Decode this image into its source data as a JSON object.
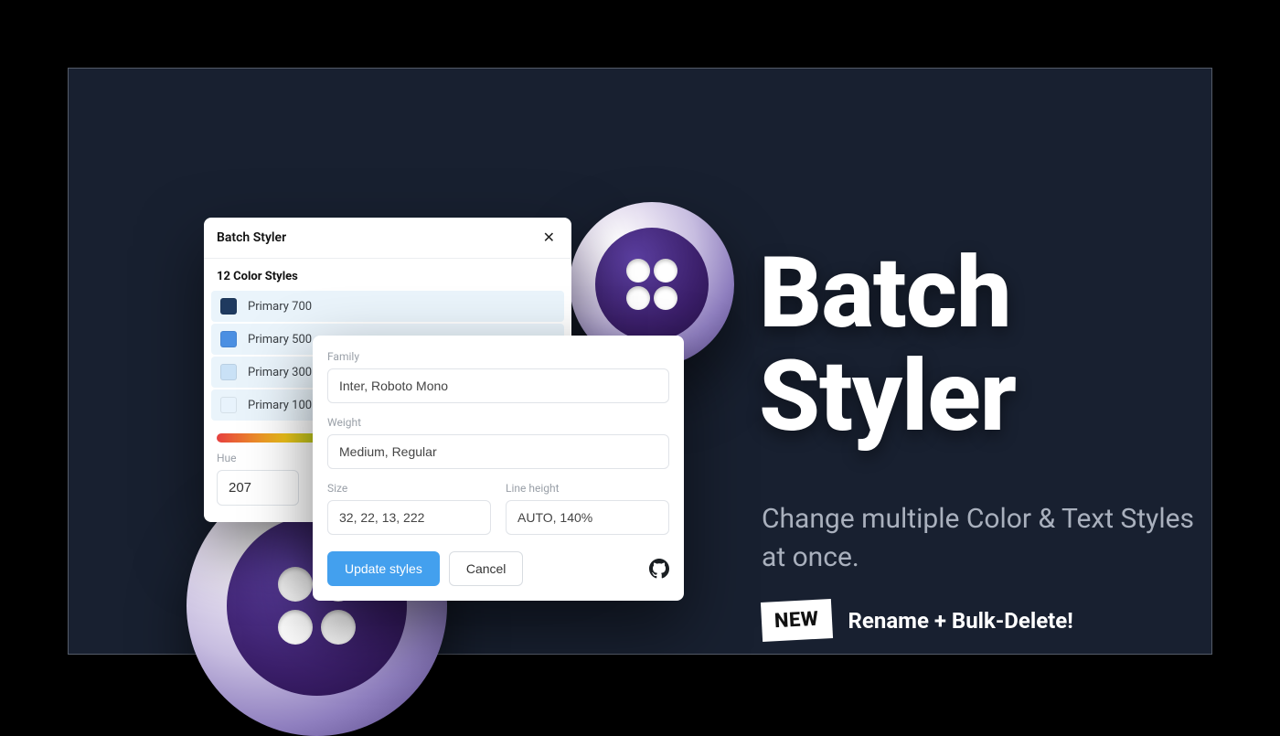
{
  "hero": {
    "title_line1": "Batch",
    "title_line2": "Styler",
    "subtitle": "Change multiple Color & Text Styles at once.",
    "new_badge": "NEW",
    "new_text": "Rename + Bulk-Delete!"
  },
  "panel1": {
    "title": "Batch Styler",
    "section_title": "12 Color Styles",
    "items": [
      {
        "label": "Primary 700",
        "color": "#1f3a5f"
      },
      {
        "label": "Primary 500",
        "color": "#4b8fe2"
      },
      {
        "label": "Primary 300",
        "color": "#c9e1f6"
      },
      {
        "label": "Primary 100",
        "color": "#e8f3fc"
      }
    ],
    "hue_label": "Hue",
    "hue_value": "207",
    "hue_thumb_percent": 70
  },
  "panel2": {
    "family_label": "Family",
    "family_value": "Inter, Roboto Mono",
    "weight_label": "Weight",
    "weight_value": "Medium, Regular",
    "size_label": "Size",
    "size_value": "32, 22, 13, 222",
    "lineheight_label": "Line height",
    "lineheight_value": "AUTO, 140%",
    "update_label": "Update styles",
    "cancel_label": "Cancel"
  }
}
